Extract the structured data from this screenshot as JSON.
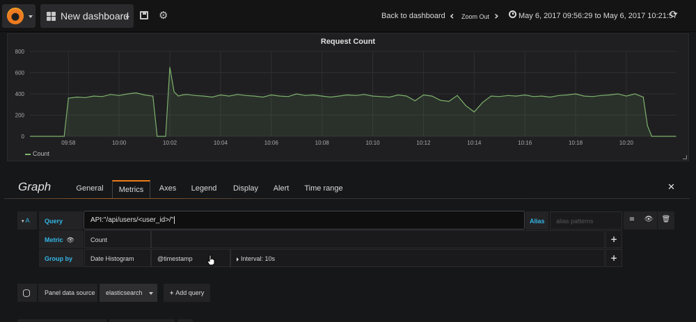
{
  "topnav": {
    "dashboard_title": "New dashboard",
    "back_label": "Back to dashboard",
    "zoom_out_label": "Zoom Out",
    "time_range": "May 6, 2017 09:56:29 to May 6, 2017 10:21:57"
  },
  "panel": {
    "title": "Request Count",
    "legend_label": "Count"
  },
  "chart_data": {
    "type": "area",
    "title": "Request Count",
    "xlabel": "",
    "ylabel": "",
    "ylim": [
      0,
      800
    ],
    "y_ticks": [
      "800",
      "600",
      "400",
      "200",
      "0"
    ],
    "x_ticks": [
      "09:58",
      "10:00",
      "10:02",
      "10:04",
      "10:06",
      "10:08",
      "10:10",
      "10:12",
      "10:14",
      "10:16",
      "10:18",
      "10:20"
    ],
    "grid": true,
    "legend_position": "bottom-left",
    "series": [
      {
        "name": "Count",
        "color": "#7eb26d",
        "x": [
          "09:56:30",
          "09:57:00",
          "09:57:30",
          "09:57:40",
          "09:57:50",
          "09:58:00",
          "09:58:20",
          "09:58:40",
          "09:59:00",
          "09:59:20",
          "09:59:40",
          "10:00:00",
          "10:00:20",
          "10:00:40",
          "10:01:00",
          "10:01:20",
          "10:01:30",
          "10:01:40",
          "10:01:50",
          "10:02:00",
          "10:02:10",
          "10:02:20",
          "10:02:30",
          "10:02:40",
          "10:03:00",
          "10:03:20",
          "10:03:40",
          "10:04:00",
          "10:04:20",
          "10:04:40",
          "10:05:00",
          "10:05:20",
          "10:05:40",
          "10:06:00",
          "10:06:20",
          "10:06:40",
          "10:07:00",
          "10:07:20",
          "10:07:40",
          "10:08:00",
          "10:08:20",
          "10:08:40",
          "10:09:00",
          "10:09:20",
          "10:09:40",
          "10:10:00",
          "10:10:20",
          "10:10:40",
          "10:11:00",
          "10:11:20",
          "10:11:40",
          "10:12:00",
          "10:12:20",
          "10:12:40",
          "10:13:00",
          "10:13:20",
          "10:13:40",
          "10:14:00",
          "10:14:20",
          "10:14:40",
          "10:15:00",
          "10:15:20",
          "10:15:40",
          "10:16:00",
          "10:16:20",
          "10:16:40",
          "10:17:00",
          "10:17:20",
          "10:17:40",
          "10:18:00",
          "10:18:20",
          "10:18:40",
          "10:19:00",
          "10:19:20",
          "10:19:40",
          "10:20:00",
          "10:20:20",
          "10:20:40",
          "10:20:50",
          "10:21:00",
          "10:21:30",
          "10:21:57"
        ],
        "values": [
          0,
          0,
          0,
          0,
          0,
          360,
          370,
          365,
          380,
          375,
          395,
          385,
          400,
          410,
          390,
          380,
          0,
          0,
          0,
          650,
          420,
          380,
          390,
          395,
          385,
          380,
          370,
          390,
          380,
          395,
          385,
          380,
          370,
          390,
          380,
          375,
          400,
          385,
          390,
          380,
          370,
          380,
          390,
          385,
          395,
          380,
          375,
          370,
          390,
          380,
          335,
          390,
          380,
          340,
          330,
          385,
          290,
          230,
          320,
          380,
          375,
          385,
          380,
          390,
          375,
          380,
          370,
          385,
          390,
          400,
          380,
          375,
          385,
          390,
          400,
          380,
          400,
          370,
          100,
          0,
          0,
          0
        ]
      }
    ]
  },
  "editor": {
    "title": "Graph",
    "tabs": [
      "General",
      "Metrics",
      "Axes",
      "Legend",
      "Display",
      "Alert",
      "Time range"
    ],
    "active_tab": "Metrics",
    "query": {
      "ref_id": "A",
      "query_label": "Query",
      "query_value": "API:\"/api/users/<user_id>/\"",
      "alias_label": "Alias",
      "alias_placeholder": "alias patterns",
      "metric_label": "Metric",
      "metric_value": "Count",
      "group_by_label": "Group by",
      "group_by_type": "Date Histogram",
      "group_by_field": "@timestamp",
      "interval_text": "Interval: 10s"
    },
    "bottom": {
      "panel_data_source_label": "Panel data source",
      "data_source_value": "elasticsearch",
      "add_query_label": "Add query"
    }
  }
}
